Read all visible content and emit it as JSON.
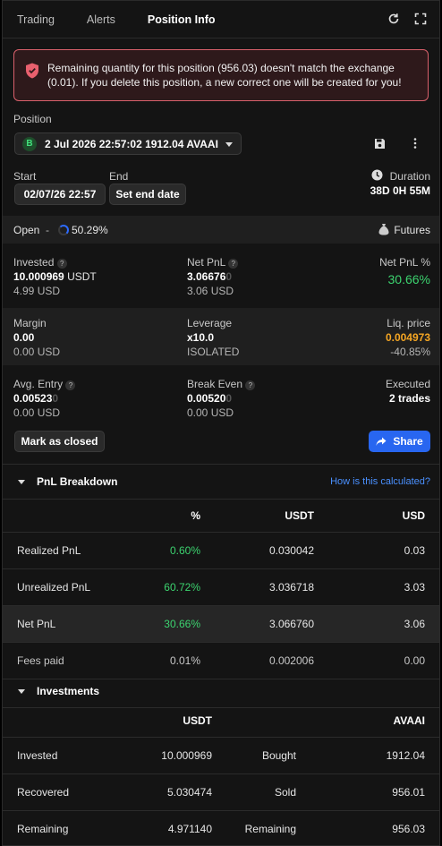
{
  "tabs": [
    "Trading",
    "Alerts",
    "Position Info"
  ],
  "alert": {
    "text": "Remaining quantity for this position (956.03) doesn't match the exchange (0.01). If you delete this position, a new correct one will be created for you!"
  },
  "position": {
    "label": "Position",
    "side_badge": "B",
    "selected": "2 Jul 2026 22:57:02 1912.04 AVAAI"
  },
  "dates": {
    "start_label": "Start",
    "start_value": "02/07/26 22:57",
    "end_label": "End",
    "end_button": "Set end date",
    "duration_label": "Duration",
    "duration_value": "38D 0H 55M"
  },
  "status": {
    "open_label": "Open",
    "separator": "-",
    "progress_text": "50.29%",
    "progress_fraction": 0.5029,
    "market": "Futures"
  },
  "stats": {
    "invested_label": "Invested",
    "invested_value": "10.000969",
    "invested_unit": "USDT",
    "invested_usd": "4.99 USD",
    "netpnl_label": "Net PnL",
    "netpnl_value": "3.06676",
    "netpnl_faded": "0",
    "netpnl_usd": "3.06 USD",
    "netpnl_pct_label": "Net PnL %",
    "netpnl_pct_value": "30.66%",
    "margin_label": "Margin",
    "margin_value": "0.00",
    "margin_usd": "0.00 USD",
    "leverage_label": "Leverage",
    "leverage_value": "x10.0",
    "leverage_mode": "ISOLATED",
    "liq_label": "Liq. price",
    "liq_value": "0.004973",
    "liq_pct": "-40.85%",
    "avg_label": "Avg. Entry",
    "avg_value": "0.00523",
    "avg_faded": "0",
    "avg_usd": "0.00 USD",
    "be_label": "Break Even",
    "be_value": "0.00520",
    "be_faded": "0",
    "be_usd": "0.00 USD",
    "executed_label": "Executed",
    "executed_value": "2 trades"
  },
  "buttons": {
    "mark_closed": "Mark as closed",
    "share": "Share"
  },
  "pnl": {
    "title": "PnL Breakdown",
    "link": "How is this calculated?",
    "headers": [
      "%",
      "USDT",
      "USD"
    ],
    "rows": [
      {
        "label": "Realized PnL",
        "pct": "0.60%",
        "usdt": "0.030042",
        "usd": "0.03"
      },
      {
        "label": "Unrealized PnL",
        "pct": "60.72%",
        "usdt": "3.036718",
        "usd": "3.03"
      },
      {
        "label": "Net PnL",
        "pct": "30.66%",
        "usdt": "3.066760",
        "usd": "3.06"
      },
      {
        "label": "Fees paid",
        "pct": "0.01%",
        "usdt": "0.002006",
        "usd": "0.00"
      }
    ]
  },
  "investments": {
    "title": "Investments",
    "headers": [
      "USDT",
      "AVAAI"
    ],
    "rows": [
      {
        "label": "Invested",
        "usdt": "10.000969",
        "label2": "Bought",
        "qty": "1912.04"
      },
      {
        "label": "Recovered",
        "usdt": "5.030474",
        "label2": "Sold",
        "qty": "956.01"
      },
      {
        "label": "Remaining",
        "usdt": "4.971140",
        "label2": "Remaining",
        "qty": "956.03"
      }
    ]
  },
  "colors": {
    "accent": "#2866f0",
    "positive": "#3cd36f",
    "warning": "#f5a623",
    "alert_border": "#d8606b"
  }
}
